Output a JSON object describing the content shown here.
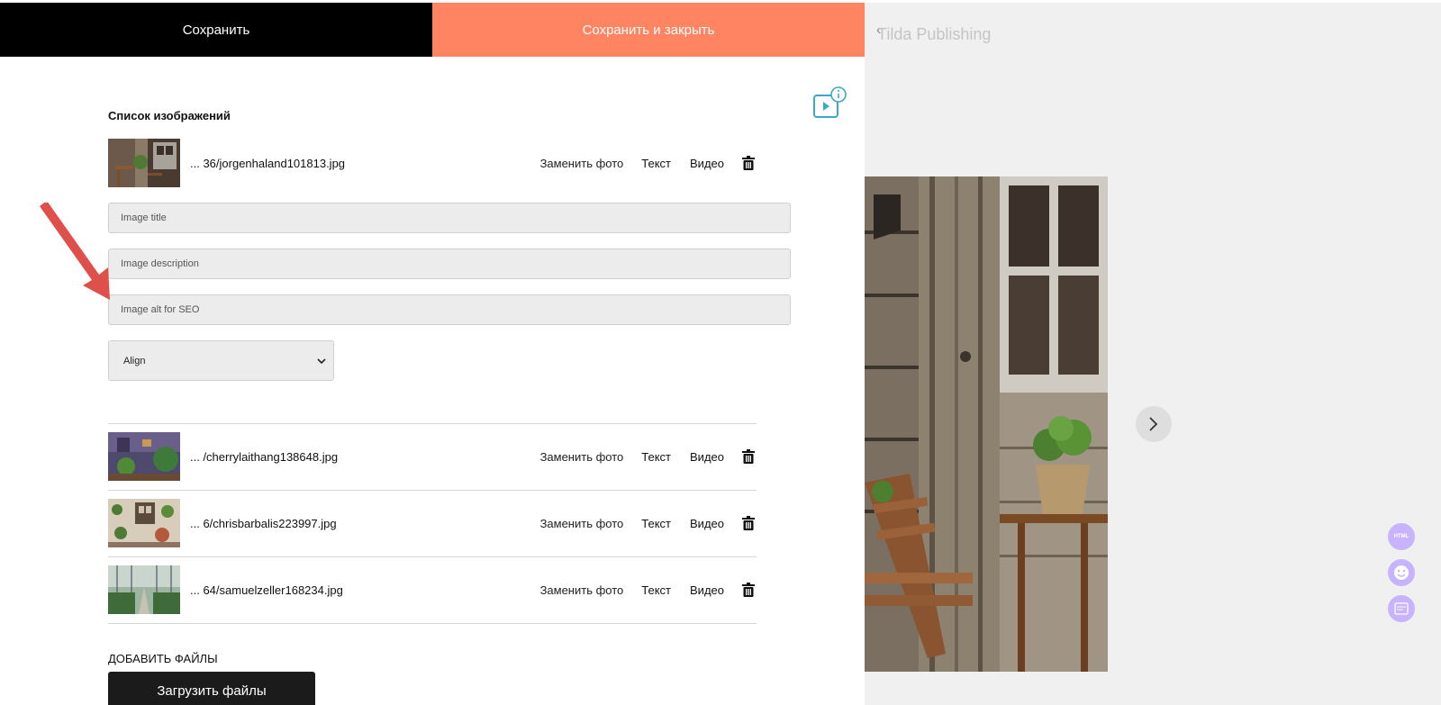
{
  "topbar": {
    "save_label": "Сохранить",
    "save_close_label": "Сохранить и закрыть",
    "save_bg": "#000000",
    "save_close_bg": "#ff8562"
  },
  "editor": {
    "section_title": "Список изображений",
    "help_icon": "video-info-icon",
    "images": [
      {
        "filename": "... 36/jorgenhaland101813.jpg",
        "replace": "Заменить фото",
        "text": "Текст",
        "video": "Видео"
      },
      {
        "filename": "... /cherrylaithang138648.jpg",
        "replace": "Заменить фото",
        "text": "Текст",
        "video": "Видео"
      },
      {
        "filename": "... 6/chrisbarbalis223997.jpg",
        "replace": "Заменить фото",
        "text": "Текст",
        "video": "Видео"
      },
      {
        "filename": "... 64/samuelzeller168234.jpg",
        "replace": "Заменить фото",
        "text": "Текст",
        "video": "Видео"
      }
    ],
    "fields": {
      "title_placeholder": "Image title",
      "description_placeholder": "Image description",
      "alt_placeholder": "Image alt for SEO"
    },
    "align": {
      "selected": "Align"
    },
    "add_files_label": "ДОБАВИТЬ ФАЙЛЫ",
    "upload_button": "Загрузить файлы",
    "arrow_color": "#e0504a"
  },
  "preview": {
    "brand": "Tilda Publishing",
    "back_glyph": "‹",
    "next_icon": "chevron-right-icon",
    "side_buttons": [
      {
        "icon": "html-icon",
        "label": "HTML"
      },
      {
        "icon": "smiley-icon",
        "label": ""
      },
      {
        "icon": "template-icon",
        "label": ""
      }
    ],
    "accent": "#c7b3ff"
  }
}
